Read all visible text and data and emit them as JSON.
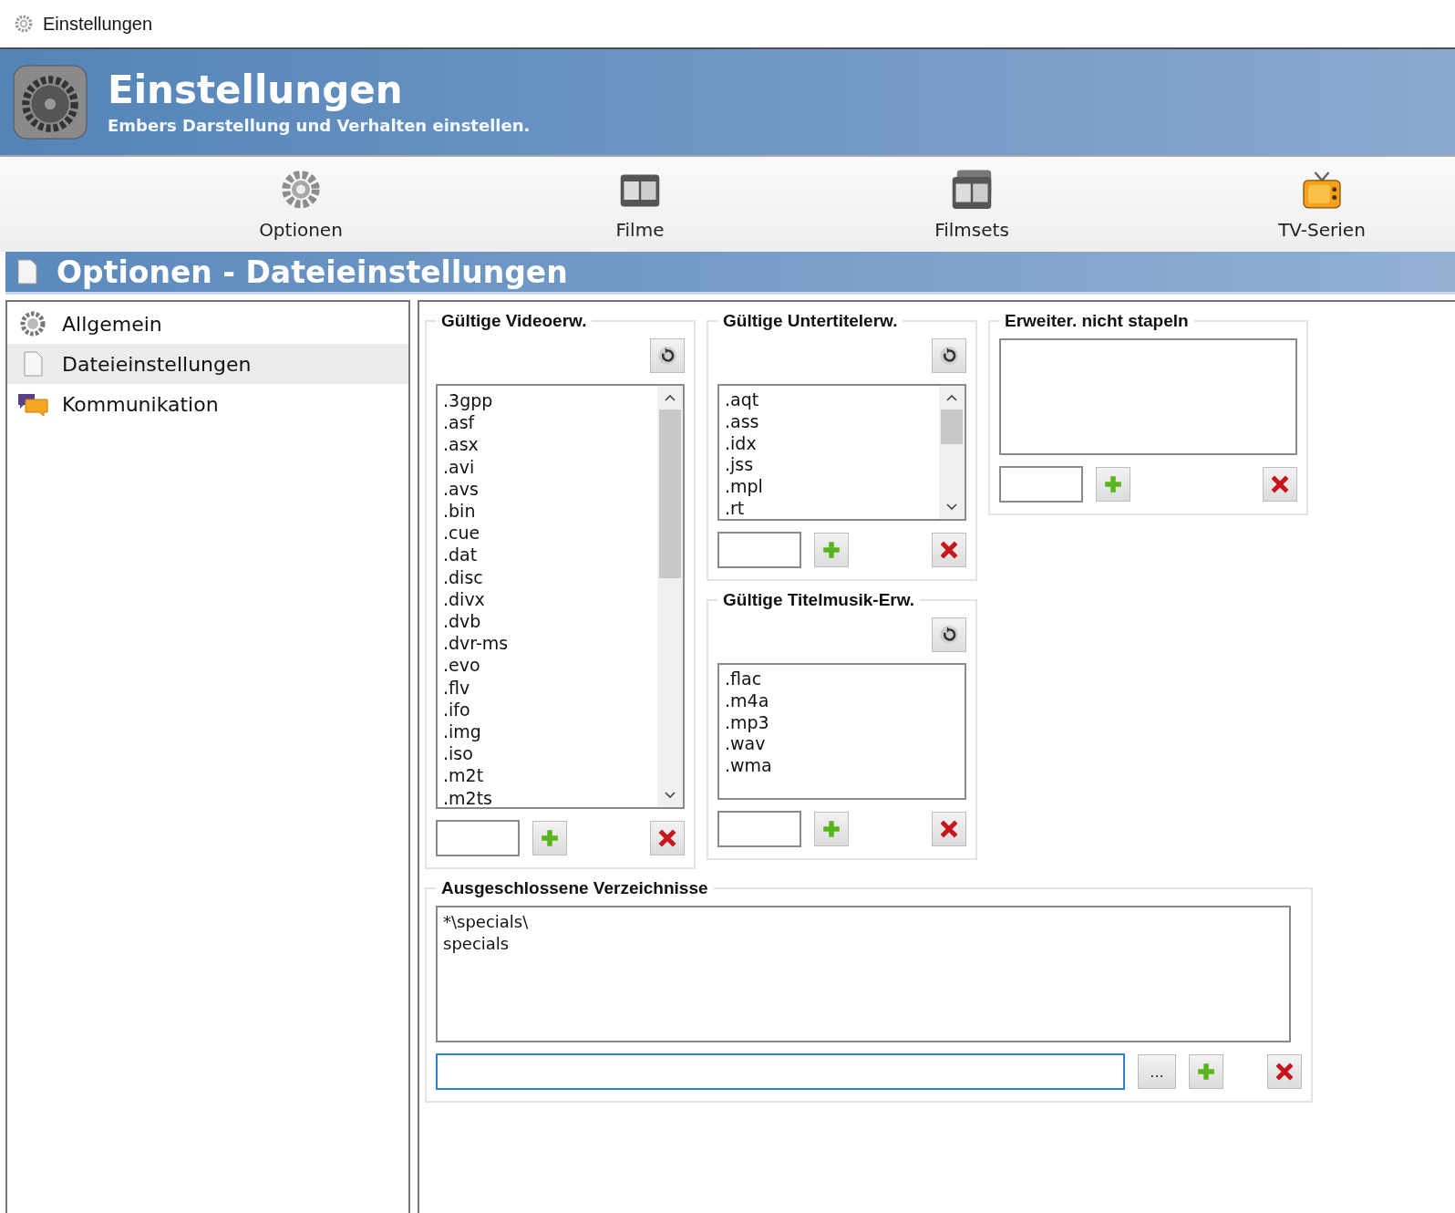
{
  "window": {
    "title": "Einstellungen"
  },
  "header": {
    "title": "Einstellungen",
    "subtitle": "Embers Darstellung und Verhalten einstellen."
  },
  "toolbar": {
    "items": [
      {
        "label": "Optionen",
        "kind": "gear"
      },
      {
        "label": "Filme",
        "kind": "film"
      },
      {
        "label": "Filmsets",
        "kind": "filmset"
      },
      {
        "label": "TV-Serien",
        "kind": "tv"
      }
    ]
  },
  "section": {
    "title": "Optionen - Dateieinstellungen"
  },
  "sidebar": {
    "items": [
      {
        "label": "Allgemein",
        "kind": "gear",
        "selected": false
      },
      {
        "label": "Dateieinstellungen",
        "kind": "file",
        "selected": true
      },
      {
        "label": "Kommunikation",
        "kind": "chat",
        "selected": false
      }
    ]
  },
  "video_extensions": {
    "title": "Gültige Videoerw.",
    "items": [
      ".3gpp",
      ".asf",
      ".asx",
      ".avi",
      ".avs",
      ".bin",
      ".cue",
      ".dat",
      ".disc",
      ".divx",
      ".dvb",
      ".dvr-ms",
      ".evo",
      ".flv",
      ".ifo",
      ".img",
      ".iso",
      ".m2t",
      ".m2ts"
    ]
  },
  "subtitle_extensions": {
    "title": "Gültige Untertitelerw.",
    "items": [
      ".aqt",
      ".ass",
      ".idx",
      ".jss",
      ".mpl",
      ".rt"
    ]
  },
  "music_extensions": {
    "title": "Gültige Titelmusik-Erw.",
    "items": [
      ".flac",
      ".m4a",
      ".mp3",
      ".wav",
      ".wma"
    ]
  },
  "no_stack_extensions": {
    "title": "Erweiter. nicht stapeln"
  },
  "excluded_folders": {
    "title": "Ausgeschlossene Verzeichnisse",
    "items": [
      "*\\specials\\",
      "specials"
    ],
    "browse_button": "..."
  }
}
